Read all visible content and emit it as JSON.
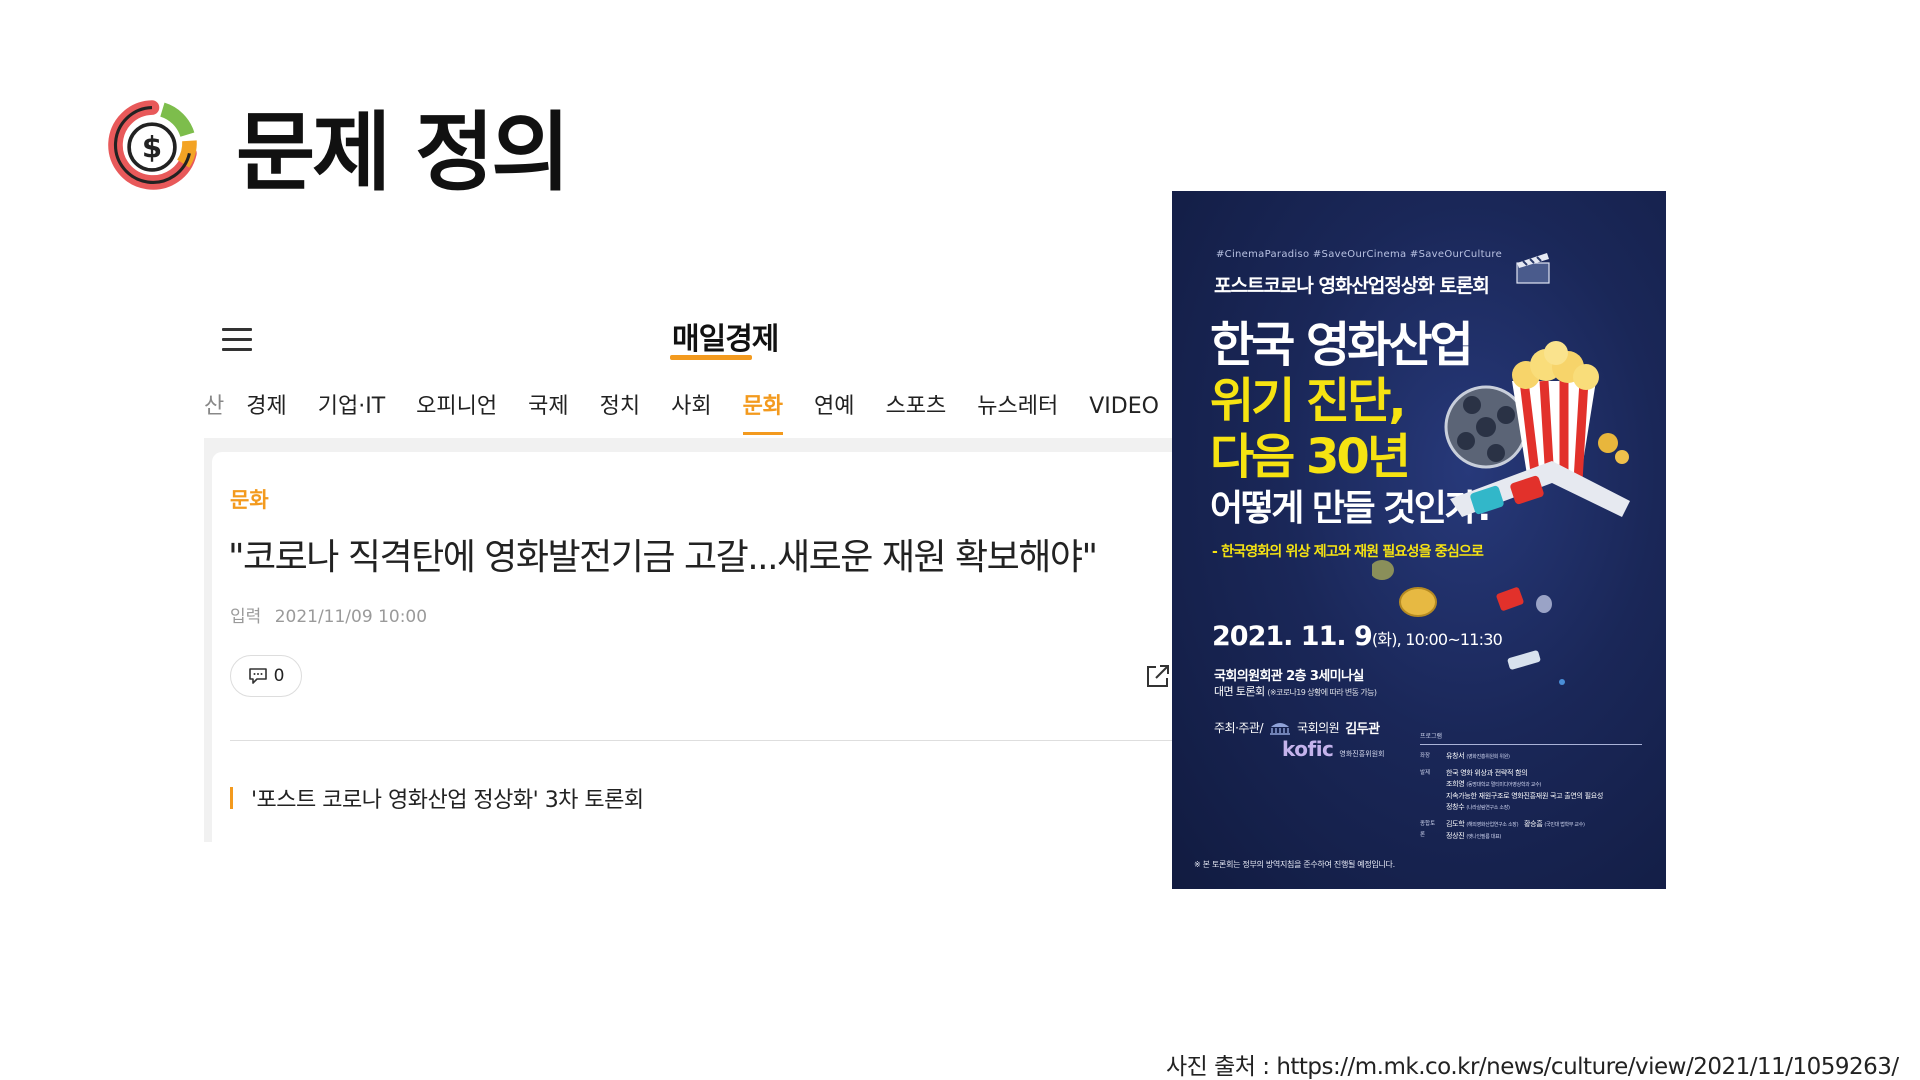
{
  "slide": {
    "title": "문제 정의",
    "icon": "money-chart-icon",
    "source_caption": "사진 출처 : https://m.mk.co.kr/news/culture/view/2021/11/1059263/"
  },
  "news": {
    "logo": "매일경제",
    "nav": [
      "산",
      "경제",
      "기업·IT",
      "오피니언",
      "국제",
      "정치",
      "사회",
      "문화",
      "연예",
      "스포츠",
      "뉴스레터",
      "VIDEO"
    ],
    "active_nav": "문화",
    "category": "문화",
    "headline": "\"코로나 직격탄에 영화발전기금 고갈...새로운 재원 확보해야\"",
    "date_label": "입력",
    "date": "2021/11/09 10:00",
    "comment_count": "0",
    "sub_headline": "'포스트 코로나 영화산업 정상화' 3차 토론회",
    "accent_color": "#f39a1e"
  },
  "poster": {
    "hashtags": "#CinemaParadiso #SaveOurCinema #SaveOurCulture",
    "subtitle": "포스트코로나 영화산업정상화 토론회",
    "title_line1": "한국 영화산업",
    "title_line2": "위기 진단,",
    "title_line3": "다음 30년",
    "title_line4": "어떻게 만들 것인가?",
    "tagline": "- 한국영화의 위상 제고와 재원 필요성을 중심으로",
    "date_main": "2021. 11. 9",
    "date_sub": "(화), 10:00~11:30",
    "venue": "국회의원회관 2층 3세미나실",
    "online": "대면 토론회",
    "online_note": "(※코로나19 상황에 따라 변동 가능)",
    "host_label": "주최·주관/",
    "host_member_label": "국회의원",
    "host_name": "김두관",
    "kofic": "kofic",
    "kofic_sub": "영화진흥위원회",
    "program_header": "프로그램",
    "program": [
      {
        "label": "좌장",
        "value": "유창서",
        "note": "(영화진흥위원회 위원)"
      },
      {
        "label": "발제",
        "value": "한국 영화 위상과 전략적 함의",
        "note": ""
      },
      {
        "label": "",
        "value": "조희영",
        "note": "(동명대학교 멀티미디어영상학과 교수)"
      },
      {
        "label": "",
        "value": "지속가능한 재원구조로 영화진흥재원 국고 출연의 필요성",
        "note": ""
      },
      {
        "label": "",
        "value": "정창수",
        "note": "(나라살림연구소 소장)"
      },
      {
        "label": "종합토론",
        "value": "김도학",
        "note": "(해외영화산업연구소 소장)"
      },
      {
        "label": "",
        "value": "황승흠",
        "note": "(국민대 법학부 교수)"
      },
      {
        "label": "",
        "value": "정상진",
        "note": "(엣나인필름 대표)"
      }
    ],
    "footnote": "※ 본 토론회는 정부의 방역지침을 준수하여 진행될 예정입니다.",
    "colors": {
      "background": "#1a2758",
      "highlight": "#f6e312"
    }
  }
}
